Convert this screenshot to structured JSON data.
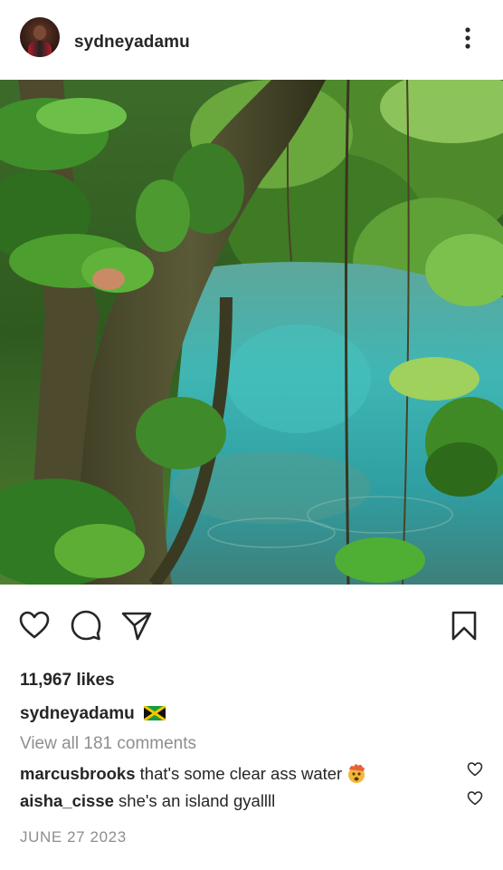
{
  "post": {
    "username": "sydneyadamu",
    "image_alt": "jungle-river-photo"
  },
  "actions": {
    "like_icon": "heart-icon",
    "comment_icon": "comment-icon",
    "share_icon": "paper-plane-icon",
    "save_icon": "bookmark-icon"
  },
  "likes": "11,967 likes",
  "caption": {
    "username": "sydneyadamu",
    "flag_icon": "jamaica-flag-icon"
  },
  "view_comments": "View all 181 comments",
  "comments": [
    {
      "username": "marcusbrooks",
      "text": "that's some clear ass water",
      "emoji": "exploding-head-emoji"
    },
    {
      "username": "aisha_cisse",
      "text": "she's an island gyallll"
    }
  ],
  "date": "JUNE 27 2023",
  "colors": {
    "text": "#262626",
    "secondary": "#8e8e8e",
    "background": "#ffffff"
  }
}
